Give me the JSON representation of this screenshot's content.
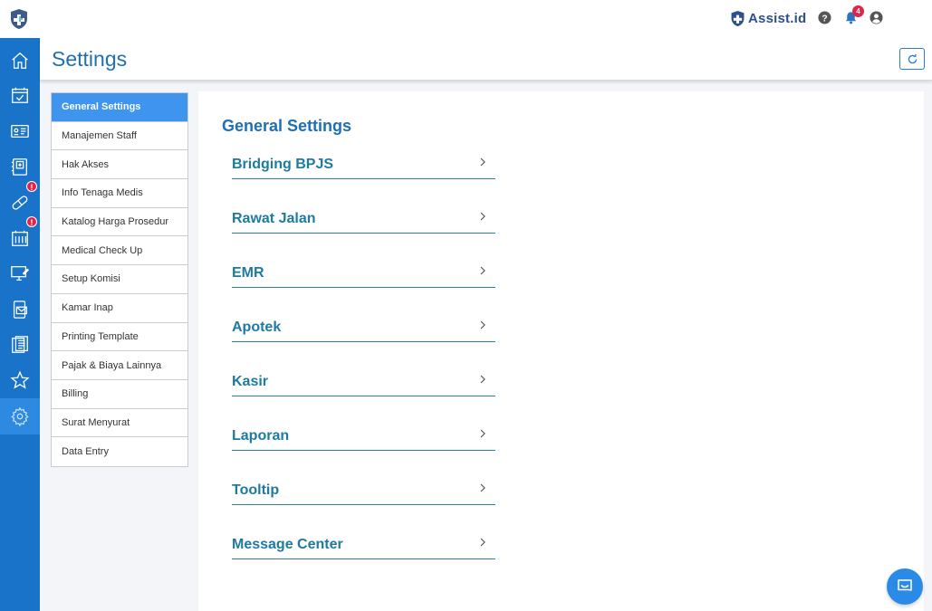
{
  "brand": {
    "name": "Assist.id"
  },
  "topbar": {
    "help_icon": "question-circle-icon",
    "notification_icon": "bell-icon",
    "notification_count": "4",
    "account_icon": "user-circle-icon"
  },
  "sidebar": {
    "items": [
      {
        "icon": "home-icon"
      },
      {
        "icon": "calendar-check-icon"
      },
      {
        "icon": "id-card-icon"
      },
      {
        "icon": "medical-record-icon"
      },
      {
        "icon": "pill-icon",
        "badge": "!"
      },
      {
        "icon": "billing-calendar-icon",
        "badge": "!"
      },
      {
        "icon": "monitor-edit-icon"
      },
      {
        "icon": "phone-mail-icon"
      },
      {
        "icon": "clipboard-icon"
      },
      {
        "icon": "star-icon"
      },
      {
        "icon": "settings-gear-icon",
        "active": true
      }
    ]
  },
  "header": {
    "title": "Settings",
    "refresh_icon": "refresh-icon"
  },
  "settings_menu": {
    "items": [
      "General Settings",
      "Manajemen Staff",
      "Hak Akses",
      "Info Tenaga Medis",
      "Katalog Harga Prosedur",
      "Medical Check Up",
      "Setup Komisi",
      "Kamar Inap",
      "Printing Template",
      "Pajak & Biaya Lainnya",
      "Billing",
      "Surat Menyurat",
      "Data Entry"
    ],
    "active_index": 0
  },
  "main": {
    "title": "General Settings",
    "rows": [
      "Bridging BPJS",
      "Rawat Jalan",
      "EMR",
      "Apotek",
      "Kasir",
      "Laporan",
      "Tooltip",
      "Message Center"
    ]
  },
  "colors": {
    "sidebar": "#1973c8",
    "accent": "#1f6fb5",
    "active_menu": "#3f95ee",
    "row_text": "#1e7aa0",
    "badge": "#e0254b"
  },
  "chat": {
    "icon": "chat-bubble-icon"
  }
}
